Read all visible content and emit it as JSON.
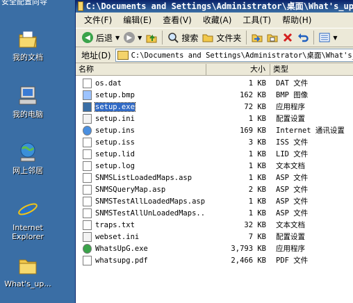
{
  "desktop": {
    "top_text": "安全配置向导",
    "icons": [
      {
        "label": "我的文档",
        "icon": "my-documents-icon"
      },
      {
        "label": "我的电脑",
        "icon": "my-computer-icon"
      },
      {
        "label": "网上邻居",
        "icon": "network-places-icon"
      },
      {
        "label": "Internet Explorer",
        "icon": "internet-explorer-icon"
      },
      {
        "label": "What's_up...",
        "icon": "folder-icon"
      }
    ]
  },
  "window": {
    "title": "C:\\Documents and Settings\\Administrator\\桌面\\What's_up",
    "menu": [
      "文件(F)",
      "编辑(E)",
      "查看(V)",
      "收藏(A)",
      "工具(T)",
      "帮助(H)"
    ],
    "toolbar": {
      "back_label": "后退",
      "search_label": "搜索",
      "folders_label": "文件夹"
    },
    "address": {
      "label": "地址(D)",
      "value": "C:\\Documents and Settings\\Administrator\\桌面\\What's_up"
    },
    "columns": {
      "name": "名称",
      "size": "大小",
      "type": "类型"
    },
    "files": [
      {
        "name": "os.dat",
        "size": "1 KB",
        "type": "DAT 文件",
        "icon": "file-icon"
      },
      {
        "name": "setup.bmp",
        "size": "162 KB",
        "type": "BMP 图像",
        "icon": "bitmap-icon"
      },
      {
        "name": "setup.exe",
        "size": "72 KB",
        "type": "应用程序",
        "icon": "setup-exe-icon",
        "selected": true
      },
      {
        "name": "setup.ini",
        "size": "1 KB",
        "type": "配置设置",
        "icon": "settings-file-icon"
      },
      {
        "name": "setup.ins",
        "size": "169 KB",
        "type": "Internet 通讯设置",
        "icon": "internet-settings-icon"
      },
      {
        "name": "setup.iss",
        "size": "3 KB",
        "type": "ISS 文件",
        "icon": "file-icon"
      },
      {
        "name": "setup.lid",
        "size": "1 KB",
        "type": "LID 文件",
        "icon": "file-icon"
      },
      {
        "name": "setup.log",
        "size": "1 KB",
        "type": "文本文档",
        "icon": "text-file-icon"
      },
      {
        "name": "SNMSListLoadedMaps.asp",
        "size": "1 KB",
        "type": "ASP 文件",
        "icon": "file-icon"
      },
      {
        "name": "SNMSQueryMap.asp",
        "size": "2 KB",
        "type": "ASP 文件",
        "icon": "file-icon"
      },
      {
        "name": "SNMSTestAllLoadedMaps.asp",
        "size": "1 KB",
        "type": "ASP 文件",
        "icon": "file-icon"
      },
      {
        "name": "SNMSTestAllUnLoadedMaps...",
        "size": "1 KB",
        "type": "ASP 文件",
        "icon": "file-icon"
      },
      {
        "name": "traps.txt",
        "size": "32 KB",
        "type": "文本文档",
        "icon": "text-file-icon"
      },
      {
        "name": "webset.ini",
        "size": "7 KB",
        "type": "配置设置",
        "icon": "settings-file-icon"
      },
      {
        "name": "WhatsUpG.exe",
        "size": "3,793 KB",
        "type": "应用程序",
        "icon": "whatsup-exe-icon"
      },
      {
        "name": "whatsupg.pdf",
        "size": "2,466 KB",
        "type": "PDF 文件",
        "icon": "pdf-file-icon"
      }
    ]
  }
}
